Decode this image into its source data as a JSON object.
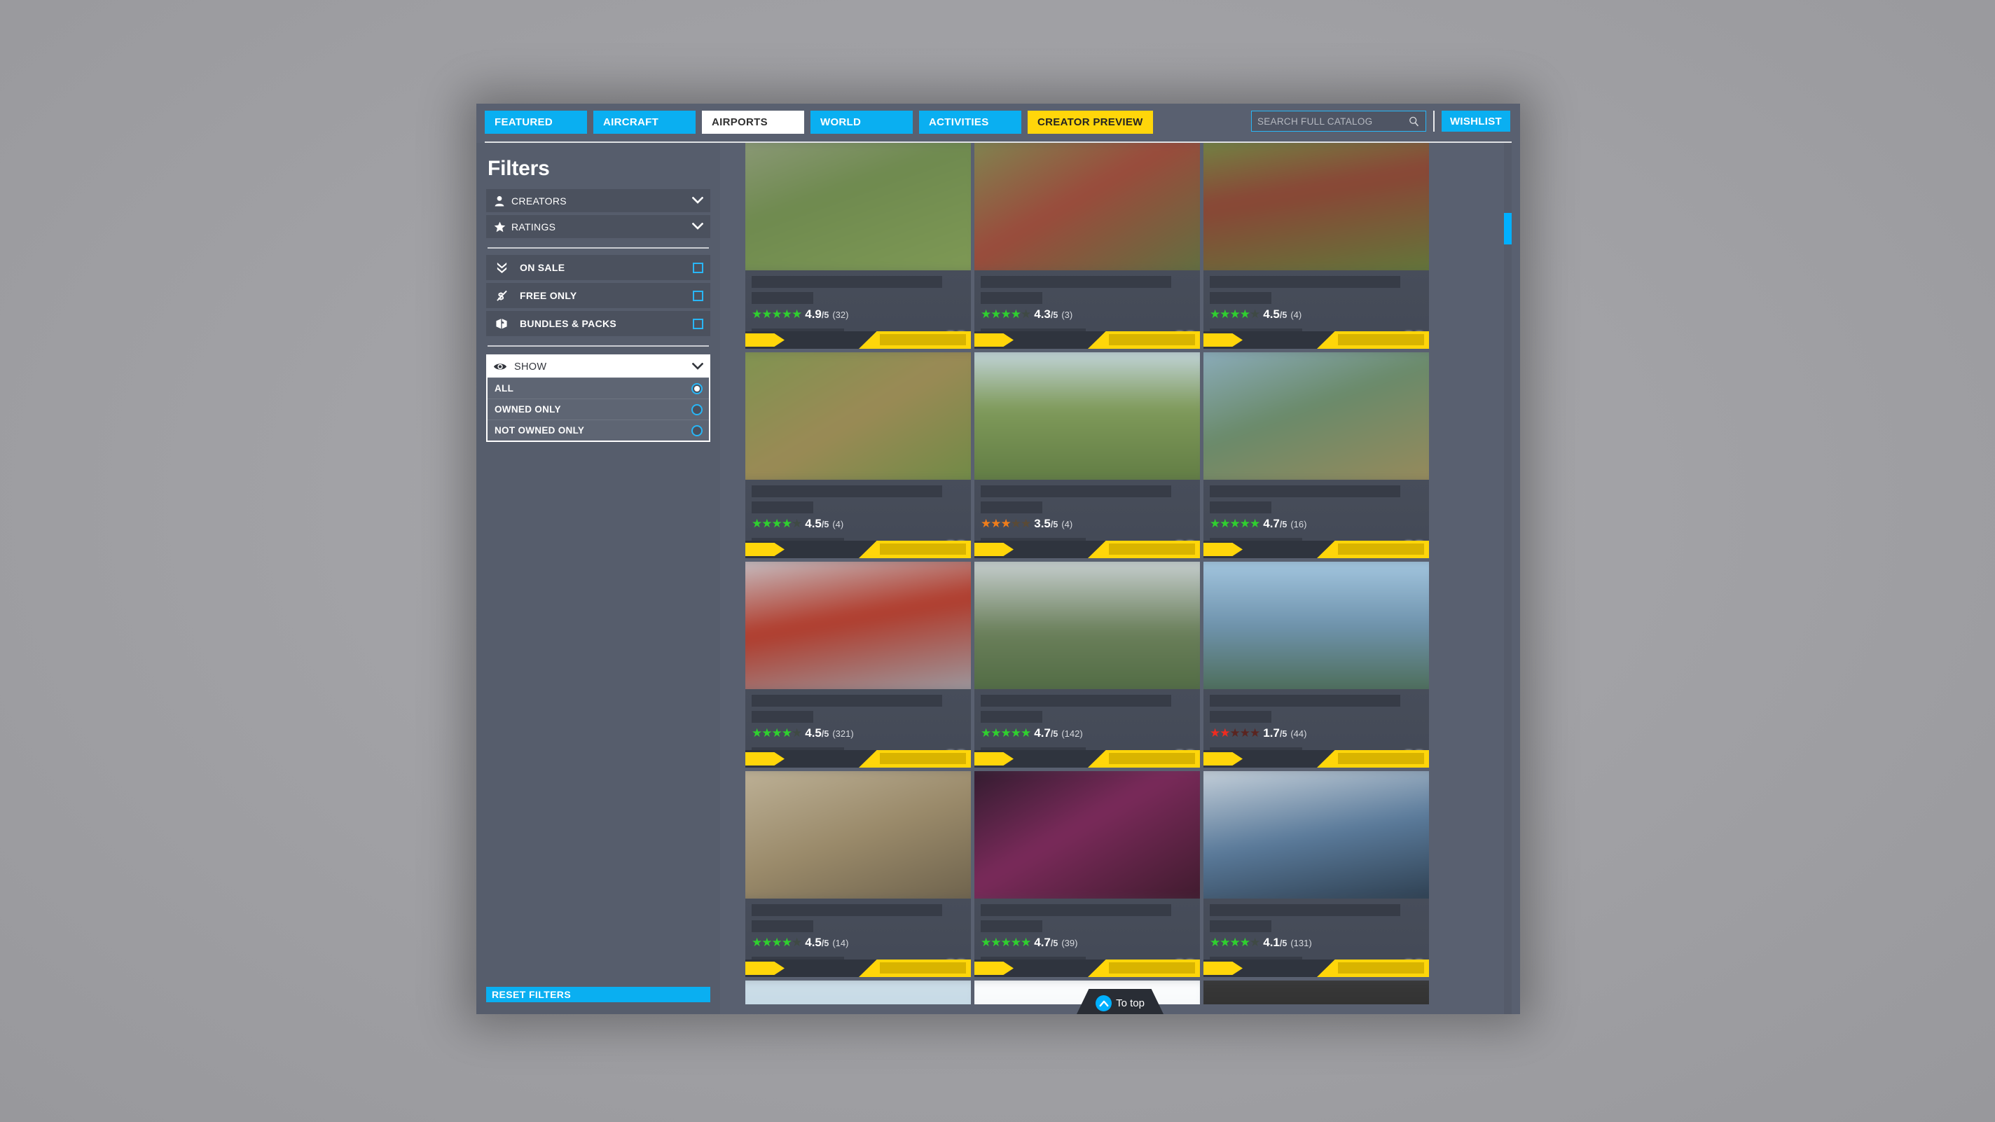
{
  "nav": {
    "tabs": [
      {
        "label": "FEATURED",
        "state": "normal"
      },
      {
        "label": "AIRCRAFT",
        "state": "normal"
      },
      {
        "label": "AIRPORTS",
        "state": "active"
      },
      {
        "label": "WORLD",
        "state": "normal"
      },
      {
        "label": "ACTIVITIES",
        "state": "normal"
      },
      {
        "label": "CREATOR PREVIEW",
        "state": "creator"
      }
    ],
    "search_placeholder": "SEARCH FULL CATALOG",
    "search_value": "",
    "search_icon": "search-icon",
    "wishlist_label": "WISHLIST"
  },
  "sidebar": {
    "title": "Filters",
    "dropdowns": [
      {
        "label": "CREATORS",
        "icon": "person-icon",
        "chevron": "chevron-down-icon"
      },
      {
        "label": "RATINGS",
        "icon": "star-icon",
        "chevron": "chevron-down-icon"
      }
    ],
    "checkboxes": [
      {
        "label": "ON SALE",
        "icon": "double-chevron-down-icon",
        "checked": false
      },
      {
        "label": "FREE ONLY",
        "icon": "dollar-slash-icon",
        "checked": false
      },
      {
        "label": "BUNDLES & PACKS",
        "icon": "box-icon",
        "checked": false
      }
    ],
    "show": {
      "header_label": "SHOW",
      "header_icon": "eye-icon",
      "chevron": "chevron-down-icon",
      "options": [
        {
          "label": "ALL",
          "selected": true
        },
        {
          "label": "OWNED ONLY",
          "selected": false
        },
        {
          "label": "NOT OWNED ONLY",
          "selected": false
        }
      ]
    },
    "reset_label": "RESET FILTERS"
  },
  "grid": {
    "cards": [
      {
        "rating": "4.9",
        "denominator": "/5",
        "count": "(32)",
        "stars": 5,
        "color": "#2fd02f",
        "thumb": "linear-gradient(160deg,#8d9a7a 0%,#6f8a4f 40%,#7f9a55 100%)"
      },
      {
        "rating": "4.3",
        "denominator": "/5",
        "count": "(3)",
        "stars": 4,
        "color": "#2fd02f",
        "thumb": "linear-gradient(150deg,#7d8a52 0%,#9a4b3c 45%,#5d7240 100%)"
      },
      {
        "rating": "4.5",
        "denominator": "/5",
        "count": "(4)",
        "stars": 4,
        "color": "#2fd02f",
        "thumb": "linear-gradient(170deg,#6f8a45 0%,#8a4536 40%,#5f7a3a 100%)"
      },
      {
        "rating": "4.5",
        "denominator": "/5",
        "count": "(4)",
        "stars": 4,
        "color": "#2fd02f",
        "thumb": "linear-gradient(150deg,#7d9450 0%,#9a8a55 50%,#6d8a45 100%)"
      },
      {
        "rating": "3.5",
        "denominator": "/5",
        "count": "(4)",
        "stars": 3,
        "color": "#f07d1a",
        "thumb": "linear-gradient(180deg,#c9dbe8 0%,#7f9a5a 45%,#5f7a42 100%)"
      },
      {
        "rating": "4.7",
        "denominator": "/5",
        "count": "(16)",
        "stars": 5,
        "color": "#2fd02f",
        "thumb": "linear-gradient(160deg,#8fb0c4 0%,#6a8a6a 45%,#9a8a5a 100%)"
      },
      {
        "rating": "4.5",
        "denominator": "/5",
        "count": "(321)",
        "stars": 4,
        "color": "#2fd02f",
        "thumb": "linear-gradient(170deg,#c8ccd2 0%,#b03a2a 45%,#9aa0a8 100%)"
      },
      {
        "rating": "4.7",
        "denominator": "/5",
        "count": "(142)",
        "stars": 5,
        "color": "#2fd02f",
        "thumb": "linear-gradient(180deg,#cfd6da 0%,#6a7f5a 55%,#4f6a42 100%)"
      },
      {
        "rating": "1.7",
        "denominator": "/5",
        "count": "(44)",
        "stars": 2,
        "color": "#ef2b1f",
        "thumb": "linear-gradient(180deg,#a8cbe4 0%,#6f93ad 50%,#4a6a52 100%)"
      },
      {
        "rating": "4.5",
        "denominator": "/5",
        "count": "(14)",
        "stars": 4,
        "color": "#2fd02f",
        "thumb": "linear-gradient(160deg,#c0b49a 0%,#9a8a6a 50%,#6a5f4a 100%)"
      },
      {
        "rating": "4.7",
        "denominator": "/5",
        "count": "(39)",
        "stars": 5,
        "color": "#2fd02f",
        "thumb": "linear-gradient(150deg,#2a1a2a 0%,#7a2a5a 45%,#3a1a2a 100%)"
      },
      {
        "rating": "4.1",
        "denominator": "/5",
        "count": "(131)",
        "stars": 4,
        "color": "#2fd02f",
        "thumb": "linear-gradient(170deg,#cfd8e0 0%,#5a7a9a 50%,#2a3a4a 100%)"
      }
    ],
    "partial_row": [
      {
        "thumb": "linear-gradient(180deg,#cfe0ea 0%,#a8c4d8 100%)"
      },
      {
        "thumb": "linear-gradient(180deg,#ffffff 0%,#dce8f0 100%)"
      },
      {
        "thumb": "linear-gradient(180deg,#3a3a3a 0%,#1a1a1a 100%)"
      }
    ]
  },
  "to_top": {
    "label": "To top",
    "icon": "chevron-up-icon"
  },
  "colors": {
    "accent_blue": "#0aaff1",
    "creator_yellow": "#ffd60a",
    "price_yellow": "#ffd60a",
    "rating_green": "#2fd02f",
    "rating_orange": "#f07d1a",
    "rating_red": "#ef2b1f",
    "scrollbar": "#00b0ff"
  }
}
